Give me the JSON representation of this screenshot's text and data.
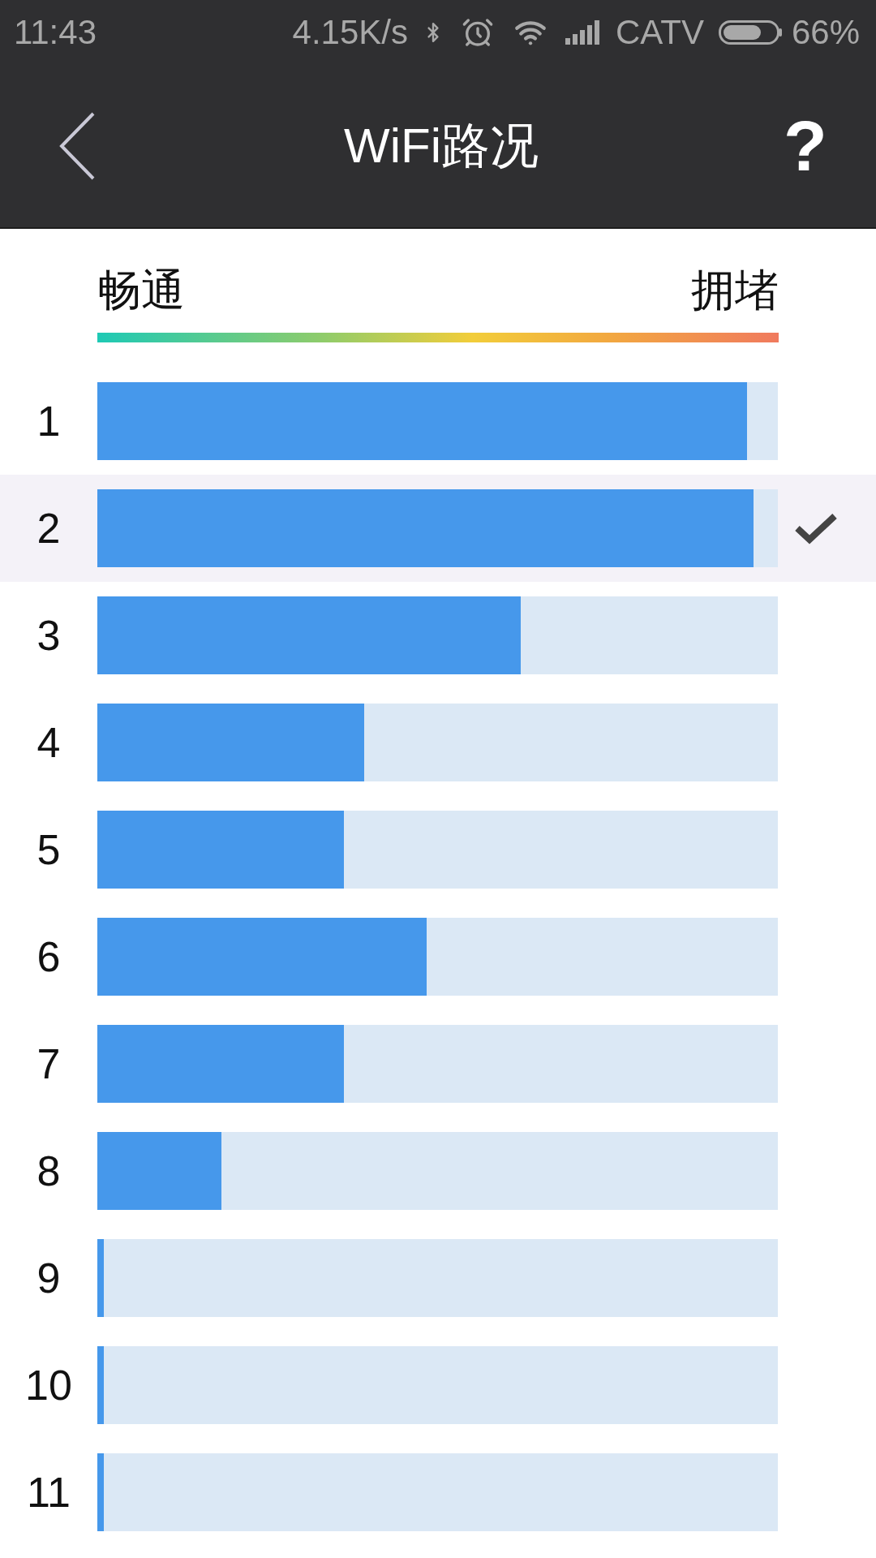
{
  "status_bar": {
    "time": "11:43",
    "net_speed": "4.15K/s",
    "carrier": "CATV",
    "battery_percent": "66%"
  },
  "header": {
    "title": "WiFi路况",
    "help": "?"
  },
  "legend": {
    "left": "畅通",
    "right": "拥堵"
  },
  "channels": [
    {
      "number": "1",
      "level": 0.955,
      "selected": false
    },
    {
      "number": "2",
      "level": 0.964,
      "selected": true
    },
    {
      "number": "3",
      "level": 0.622,
      "selected": false
    },
    {
      "number": "4",
      "level": 0.392,
      "selected": false
    },
    {
      "number": "5",
      "level": 0.362,
      "selected": false
    },
    {
      "number": "6",
      "level": 0.484,
      "selected": false
    },
    {
      "number": "7",
      "level": 0.362,
      "selected": false
    },
    {
      "number": "8",
      "level": 0.182,
      "selected": false
    },
    {
      "number": "9",
      "level": 0.009,
      "selected": false
    },
    {
      "number": "10",
      "level": 0.009,
      "selected": false
    },
    {
      "number": "11",
      "level": 0.009,
      "selected": false
    }
  ]
}
